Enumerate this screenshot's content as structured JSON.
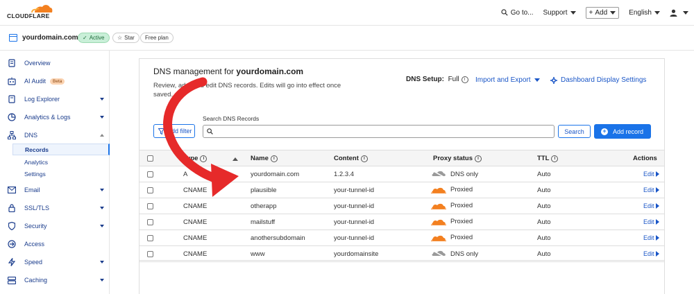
{
  "brand": {
    "name": "CLOUDFLARE",
    "accent": "#f38020"
  },
  "topbar": {
    "goto_label": "Go to...",
    "support_label": "Support",
    "add_label": "Add",
    "language_label": "English"
  },
  "zone": {
    "name": "yourdomain.com",
    "status": "Active",
    "star_label": "Star",
    "plan": "Free plan"
  },
  "sidebar": {
    "items": [
      {
        "label": "Overview",
        "icon": "document-icon"
      },
      {
        "label": "AI Audit",
        "icon": "ai-audit-icon",
        "badge": "Beta"
      },
      {
        "label": "Log Explorer",
        "icon": "log-icon"
      },
      {
        "label": "Analytics & Logs",
        "icon": "chart-icon"
      },
      {
        "label": "DNS",
        "icon": "dns-icon"
      },
      {
        "label": "Email",
        "icon": "email-icon"
      },
      {
        "label": "SSL/TLS",
        "icon": "lock-icon"
      },
      {
        "label": "Security",
        "icon": "shield-icon"
      },
      {
        "label": "Access",
        "icon": "access-icon"
      },
      {
        "label": "Speed",
        "icon": "bolt-icon"
      },
      {
        "label": "Caching",
        "icon": "caching-icon"
      }
    ],
    "dns_sub": [
      "Records",
      "Analytics",
      "Settings"
    ]
  },
  "dns": {
    "title_prefix": "DNS management for",
    "title_domain": "yourdomain.com",
    "description": "Review, add, and edit DNS records. Edits will go into effect once saved.",
    "setup_label": "DNS Setup:",
    "setup_value": "Full",
    "import_export_label": "Import and Export",
    "dashboard_settings_label": "Dashboard Display Settings",
    "filter_label": "Add filter",
    "search_label": "Search DNS Records",
    "search_placeholder": "",
    "search_button": "Search",
    "add_record_button": "Add record"
  },
  "table": {
    "headers": [
      "Type",
      "Name",
      "Content",
      "Proxy status",
      "TTL",
      "Actions"
    ],
    "rows": [
      {
        "type": "A",
        "name": "yourdomain.com",
        "content": "1.2.3.4",
        "proxy": "DNS only",
        "ttl": "Auto",
        "action": "Edit"
      },
      {
        "type": "CNAME",
        "name": "plausible",
        "content": "your-tunnel-id",
        "proxy": "Proxied",
        "ttl": "Auto",
        "action": "Edit"
      },
      {
        "type": "CNAME",
        "name": "otherapp",
        "content": "your-tunnel-id",
        "proxy": "Proxied",
        "ttl": "Auto",
        "action": "Edit"
      },
      {
        "type": "CNAME",
        "name": "mailstuff",
        "content": "your-tunnel-id",
        "proxy": "Proxied",
        "ttl": "Auto",
        "action": "Edit"
      },
      {
        "type": "CNAME",
        "name": "anothersubdomain",
        "content": "your-tunnel-id",
        "proxy": "Proxied",
        "ttl": "Auto",
        "action": "Edit"
      },
      {
        "type": "CNAME",
        "name": "www",
        "content": "yourdomainsite",
        "proxy": "DNS only",
        "ttl": "Auto",
        "action": "Edit"
      }
    ]
  },
  "colors": {
    "proxied_cloud": "#f38020",
    "dns_only_cloud": "#9a9a9a",
    "annotation_arrow": "#e62a2a",
    "link_blue": "#1a56c7"
  }
}
